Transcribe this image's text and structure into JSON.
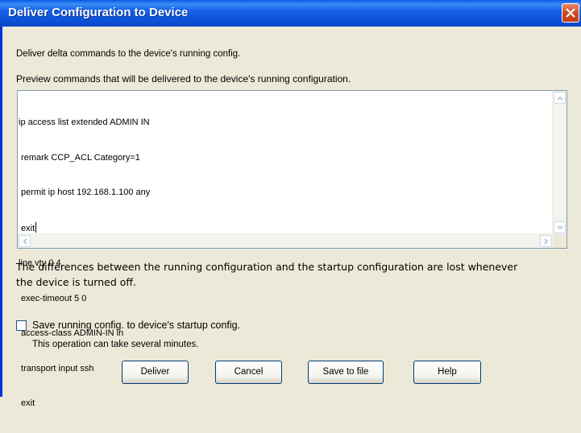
{
  "dialog": {
    "title": "Deliver Configuration to Device"
  },
  "description": "Deliver delta commands to the device's running config.",
  "preview_label": "Preview commands that will be delivered to the device's running configuration.",
  "commands": [
    "ip access list extended ADMIN IN",
    " remark CCP_ACL Category=1",
    " permit ip host 192.168.1.100 any",
    " exit",
    "line vty 0 4",
    " exec-timeout 5 0",
    " access-class ADMIN-IN in",
    " transport input ssh",
    " exit"
  ],
  "note": {
    "line1": "The differences between the running configuration and the startup configuration are lost whenever",
    "line2": "the device is turned off."
  },
  "save_option": {
    "label": "Save running config. to device's startup config.",
    "checked": false,
    "hint": "This operation can take several minutes."
  },
  "buttons": {
    "deliver": "Deliver",
    "cancel": "Cancel",
    "save_to_file": "Save to file",
    "help": "Help"
  },
  "colors": {
    "titlebar": "#0b4fd6",
    "dialog_bg": "#ece9d8",
    "close_button": "#d24a24"
  }
}
